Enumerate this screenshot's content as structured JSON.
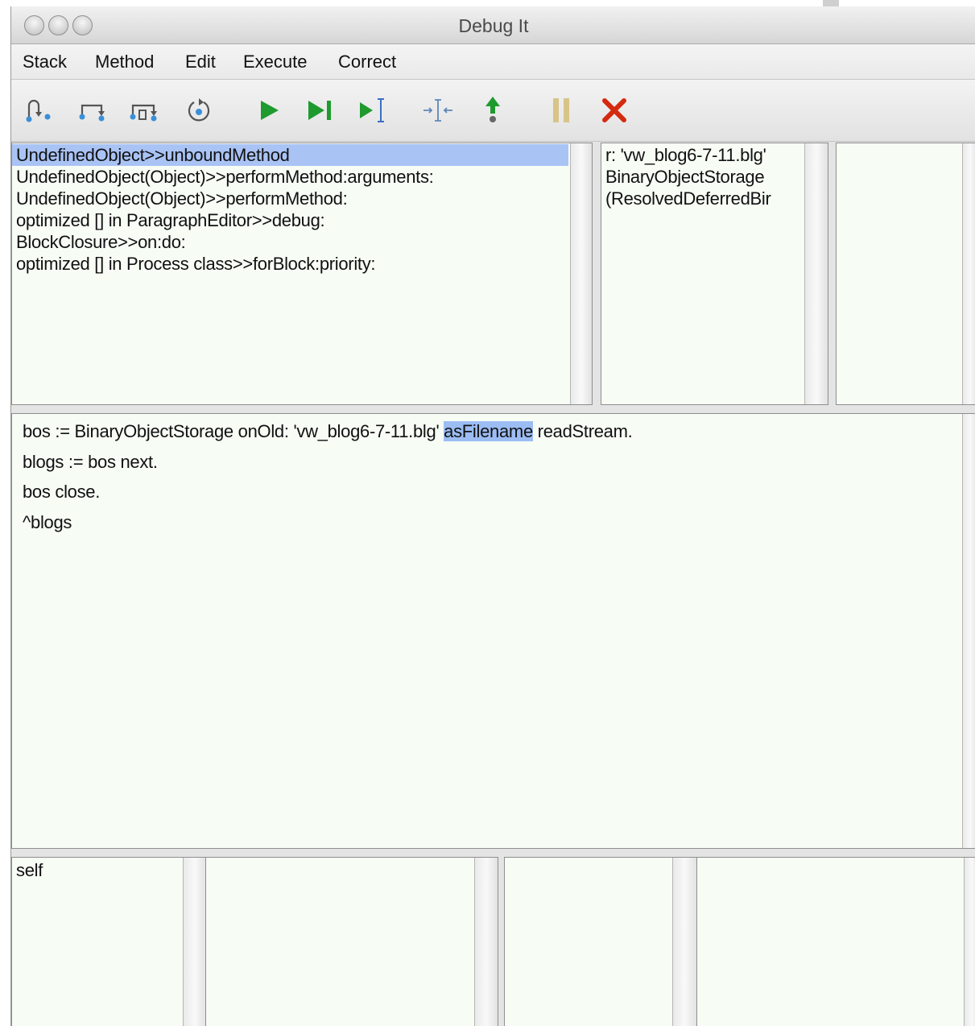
{
  "window": {
    "title": "Debug It"
  },
  "menu": [
    "Stack",
    "Method",
    "Edit",
    "Execute",
    "Correct"
  ],
  "toolbar": {
    "buttons": [
      {
        "icon": "step-into-icon",
        "color": "#3a8fd8"
      },
      {
        "icon": "step-over-icon",
        "color": "#3a8fd8"
      },
      {
        "icon": "step-over-block-icon",
        "color": "#3a8fd8"
      },
      {
        "icon": "restart-icon",
        "color": "#3a8fd8"
      },
      {
        "icon": "run-icon",
        "color": "#1e9a2e"
      },
      {
        "icon": "run-to-end-icon",
        "color": "#1e9a2e"
      },
      {
        "icon": "run-to-cursor-icon",
        "color": "#1e9a2e"
      },
      {
        "icon": "run-to-caret-icon",
        "color": "#5f87b8"
      },
      {
        "icon": "return-up-icon",
        "color": "#1e9a2e"
      },
      {
        "icon": "pause-icon",
        "color": "#d8c487"
      },
      {
        "icon": "terminate-icon",
        "color": "#d42a10"
      }
    ]
  },
  "stack": {
    "selected_index": 0,
    "frames": [
      "UndefinedObject>>unboundMethod",
      "UndefinedObject(Object)>>performMethod:arguments:",
      "UndefinedObject(Object)>>performMethod:",
      "optimized [] in ParagraphEditor>>debug:",
      "BlockClosure>>on:do:",
      "optimized [] in Process class>>forBlock:priority:"
    ]
  },
  "receiver_inspector": {
    "lines": [
      "r: 'vw_blog6-7-11.blg'",
      "BinaryObjectStorage",
      "(ResolvedDeferredBir"
    ]
  },
  "code": {
    "line1_before": "bos := BinaryObjectStorage onOld: 'vw_blog6-7-11.blg' ",
    "line1_selected": "asFilename",
    "line1_after": " readStream.",
    "line2": "blogs := bos next.",
    "line3": "bos close.",
    "line4": "^blogs",
    "selection_color": "#9cbdf4"
  },
  "variables": {
    "receiver_vars": [
      "self"
    ]
  },
  "colors": {
    "pane_background": "#f7fcf5",
    "stack_selection": "#a9c3f5"
  }
}
